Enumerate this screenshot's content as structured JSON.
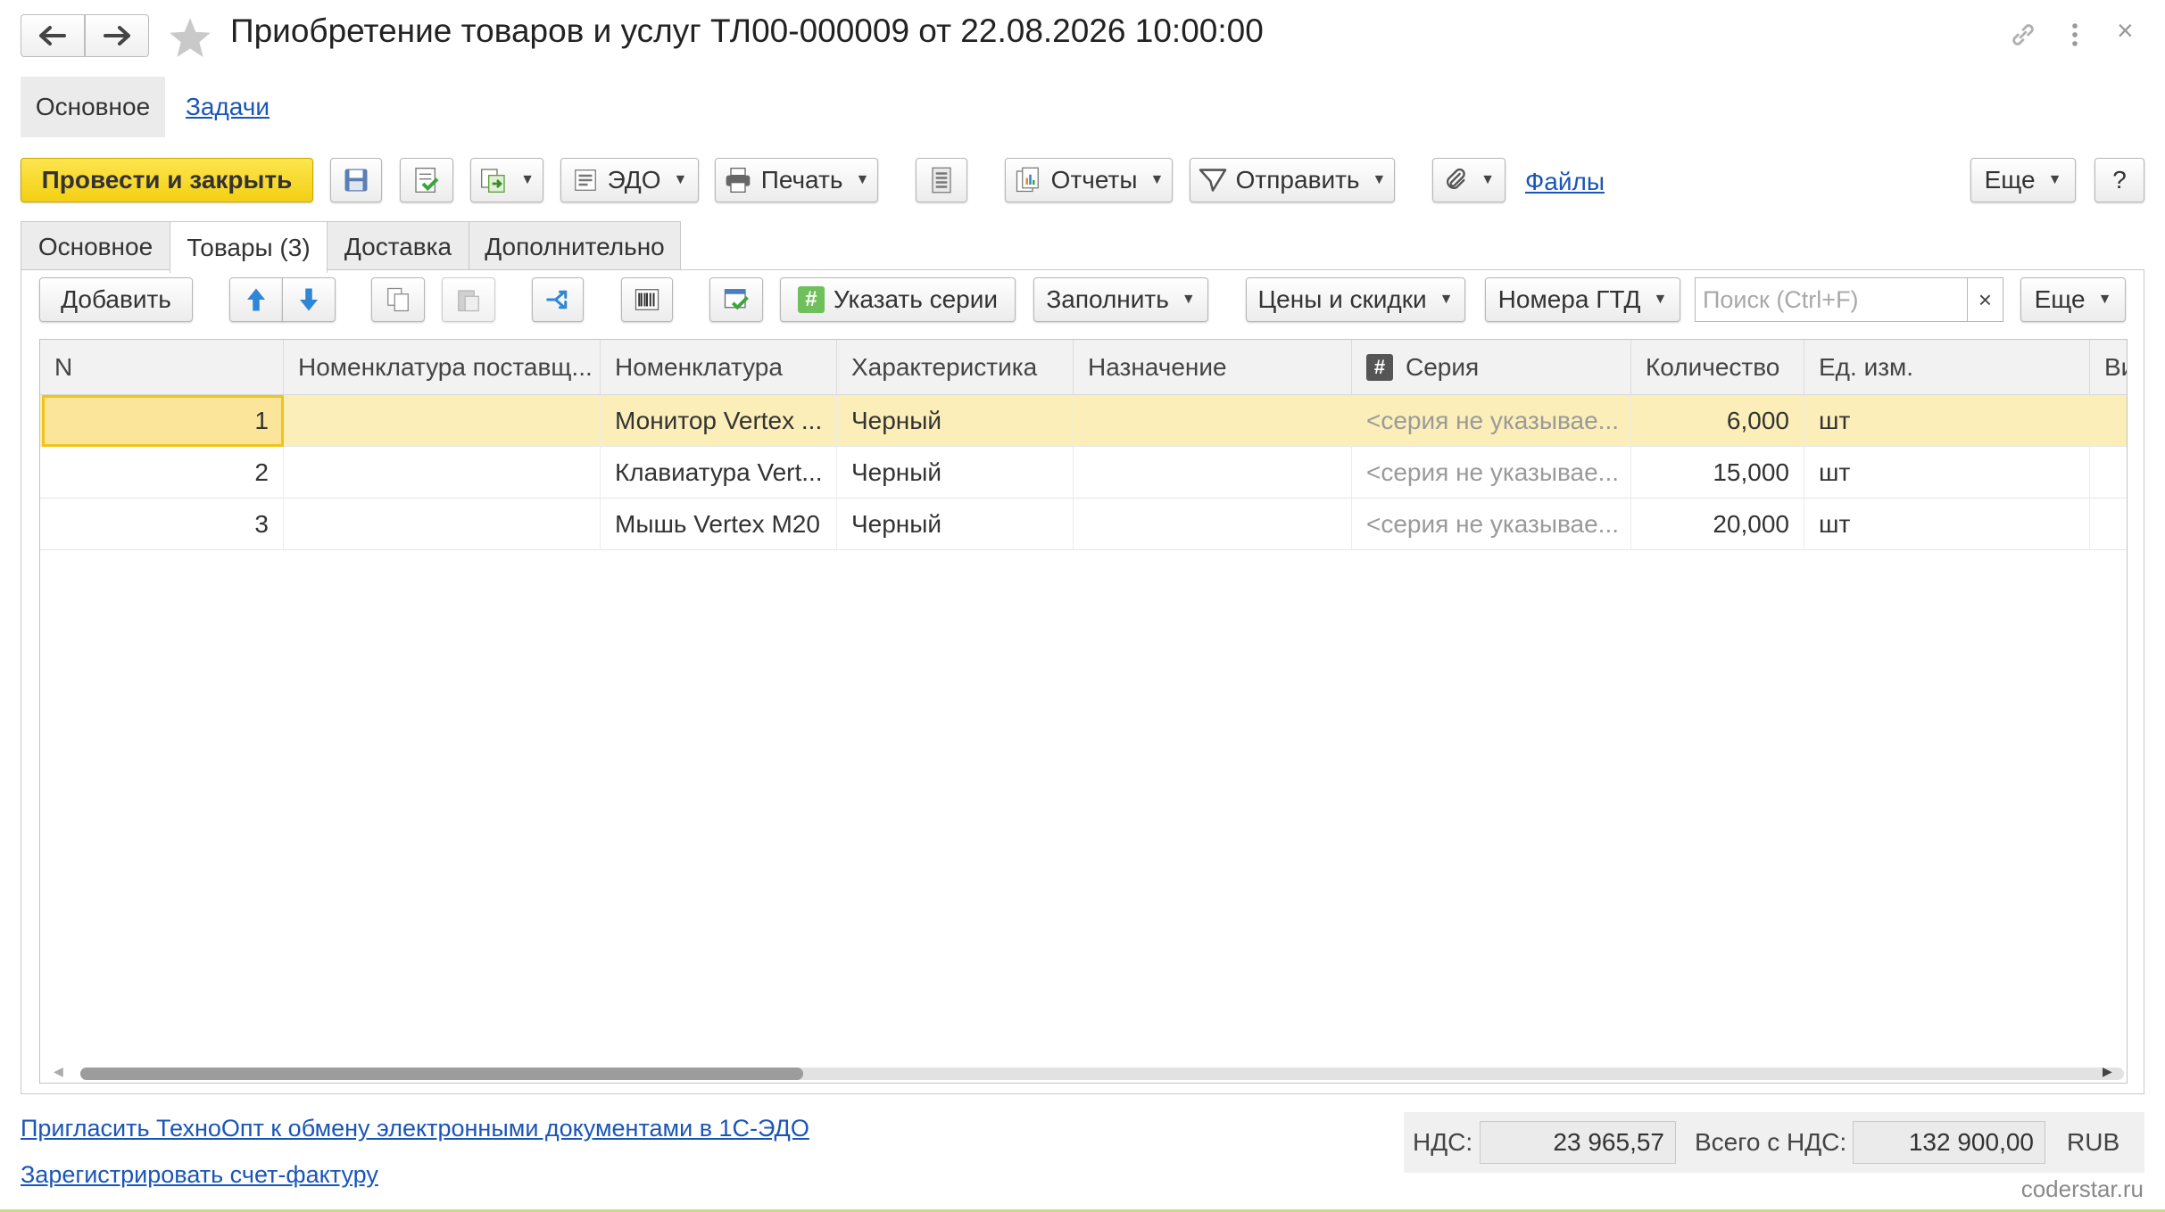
{
  "header": {
    "title": "Приобретение товаров и услуг ТЛ00-000009 от 22.08.2026 10:00:00",
    "back_icon": "arrow-left",
    "forward_icon": "arrow-right",
    "favorite_icon": "star",
    "link_icon": "chain-link",
    "more_icon": "vertical-dots",
    "close_label": "×"
  },
  "sections": [
    {
      "label": "Основное"
    },
    {
      "label": "Задачи"
    }
  ],
  "toolbar": {
    "post_close": "Провести и закрыть",
    "edo": "ЭДО",
    "print": "Печать",
    "reports": "Отчеты",
    "send": "Отправить",
    "files": "Файлы",
    "more": "Еще",
    "help": "?"
  },
  "tabs": [
    {
      "label": "Основное"
    },
    {
      "label": "Товары (3)"
    },
    {
      "label": "Доставка"
    },
    {
      "label": "Дополнительно"
    }
  ],
  "grid_toolbar": {
    "add": "Добавить",
    "series": "Указать серии",
    "fill": "Заполнить",
    "prices": "Цены и скидки",
    "gtd": "Номера ГТД",
    "search_placeholder": "Поиск (Ctrl+F)",
    "search_clear": "×",
    "more": "Еще"
  },
  "grid": {
    "columns": [
      "N",
      "Номенклатура поставщ...",
      "Номенклатура",
      "Характеристика",
      "Назначение",
      "Серия",
      "Количество",
      "Ед. изм.",
      "Ви"
    ],
    "rows": [
      {
        "n": "1",
        "supplier_item": "",
        "item": "Монитор Vertex ...",
        "characteristic": "Черный",
        "purpose": "",
        "series": "<серия не указывае...",
        "quantity": "6,000",
        "unit": "шт"
      },
      {
        "n": "2",
        "supplier_item": "",
        "item": "Клавиатура Vert...",
        "characteristic": "Черный",
        "purpose": "",
        "series": "<серия не указывае...",
        "quantity": "15,000",
        "unit": "шт"
      },
      {
        "n": "3",
        "supplier_item": "",
        "item": "Мышь Vertex M20",
        "characteristic": "Черный",
        "purpose": "",
        "series": "<серия не указывае...",
        "quantity": "20,000",
        "unit": "шт"
      }
    ]
  },
  "footer": {
    "invite_link": "Пригласить ТехноОпт к обмену электронными документами в 1С-ЭДО",
    "register_link": "Зарегистрировать счет-фактуру",
    "vat_label": "НДС:",
    "vat_value": "23 965,57",
    "total_label": "Всего с НДС:",
    "total_value": "132 900,00",
    "currency": "RUB"
  },
  "watermark": "coderstar.ru",
  "colors": {
    "primary": "#f4cf14",
    "link": "#1a55b8",
    "selected_row": "#fbeeb8",
    "series_icon": "#6fbf5b"
  }
}
